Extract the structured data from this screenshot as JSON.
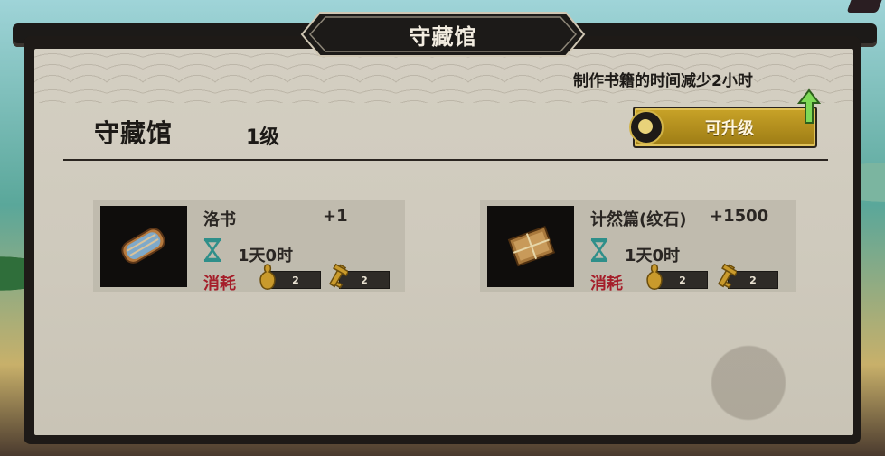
{
  "window": {
    "title": "守藏馆"
  },
  "header": {
    "bonus_text": "制作书籍的时间减少2小时",
    "building_name": "守藏馆",
    "building_level": "1级",
    "upgrade_button": "可升级"
  },
  "recipes": [
    {
      "name": "洛书",
      "qty": "+1",
      "time": "1天0时",
      "cost_label": "消耗",
      "costs": [
        {
          "icon": "gourd-icon",
          "amount": "2"
        },
        {
          "icon": "key-icon",
          "amount": "2"
        }
      ]
    },
    {
      "name": "计然篇(纹石)",
      "qty": "+1500",
      "time": "1天0时",
      "cost_label": "消耗",
      "costs": [
        {
          "icon": "gourd-icon",
          "amount": "2"
        },
        {
          "icon": "key-icon",
          "amount": "2"
        }
      ]
    }
  ],
  "colors": {
    "accent_gold": "#c9a328",
    "cost_red": "#a51e2a",
    "hourglass_teal": "#2f8f8a",
    "panel_dark": "#1e1a17"
  }
}
